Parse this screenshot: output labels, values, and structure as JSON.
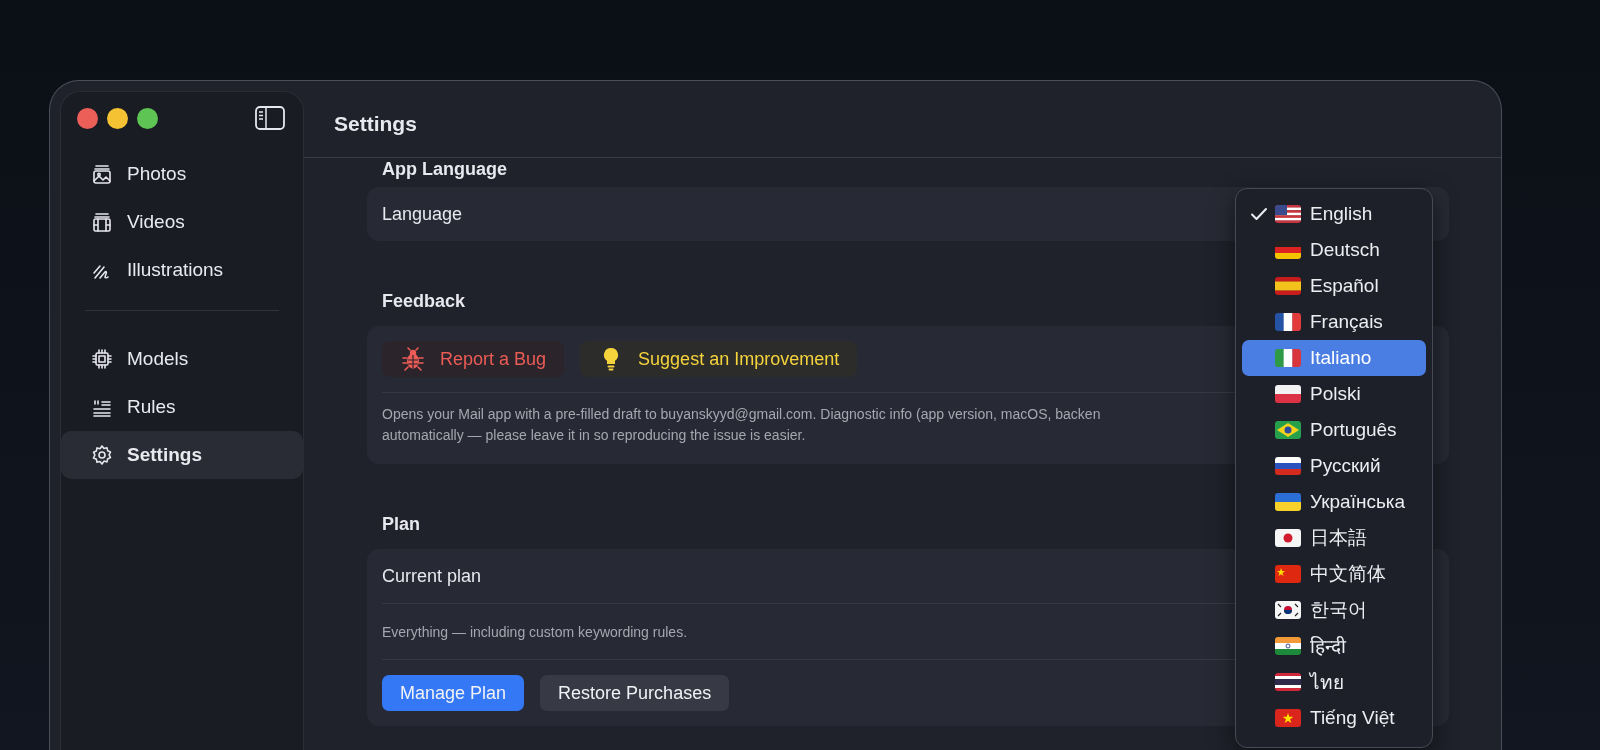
{
  "window": {
    "title": "Settings"
  },
  "sidebar": {
    "sections": [
      [
        {
          "label": "Photos",
          "selected": false
        },
        {
          "label": "Videos",
          "selected": false
        },
        {
          "label": "Illustrations",
          "selected": false
        }
      ],
      [
        {
          "label": "Models",
          "selected": false
        },
        {
          "label": "Rules",
          "selected": false
        },
        {
          "label": "Settings",
          "selected": true
        }
      ]
    ]
  },
  "sections": [
    {
      "kind": "language",
      "heading": "App Language",
      "label": "Language"
    },
    {
      "kind": "feedback",
      "heading": "Feedback",
      "buttons": [
        {
          "kind": "danger",
          "label": "Report a Bug"
        },
        {
          "kind": "suggestion",
          "label": "Suggest an Improvement"
        }
      ],
      "note_lines": [
        "Opens your Mail app with a pre-filled draft to buyanskyyd@gmail.com. Diagnostic info (app version, macOS, backen",
        "automatically — please leave it in so reproducing the issue is easier."
      ]
    },
    {
      "kind": "plan",
      "heading": "Plan",
      "label": "Current plan",
      "note": "Everything — including custom keywording rules.",
      "buttons": [
        {
          "kind": "primary",
          "label": "Manage Plan"
        },
        {
          "kind": "secondary",
          "label": "Restore Purchases"
        }
      ]
    }
  ],
  "language_menu": {
    "items": [
      {
        "label": "English",
        "checked": true,
        "selected": false
      },
      {
        "label": "Deutsch",
        "checked": false,
        "selected": false
      },
      {
        "label": "Español",
        "checked": false,
        "selected": false
      },
      {
        "label": "Français",
        "checked": false,
        "selected": false
      },
      {
        "label": "Italiano",
        "checked": false,
        "selected": true
      },
      {
        "label": "Polski",
        "checked": false,
        "selected": false
      },
      {
        "label": "Português",
        "checked": false,
        "selected": false
      },
      {
        "label": "Русский",
        "checked": false,
        "selected": false
      },
      {
        "label": "Українська",
        "checked": false,
        "selected": false
      },
      {
        "label": "日本語",
        "checked": false,
        "selected": false
      },
      {
        "label": "中文简体",
        "checked": false,
        "selected": false
      },
      {
        "label": "한국어",
        "checked": false,
        "selected": false
      },
      {
        "label": "हिन्दी",
        "checked": false,
        "selected": false
      },
      {
        "label": "ไทย",
        "checked": false,
        "selected": false
      },
      {
        "label": "Tiếng Việt",
        "checked": false,
        "selected": false
      }
    ]
  }
}
